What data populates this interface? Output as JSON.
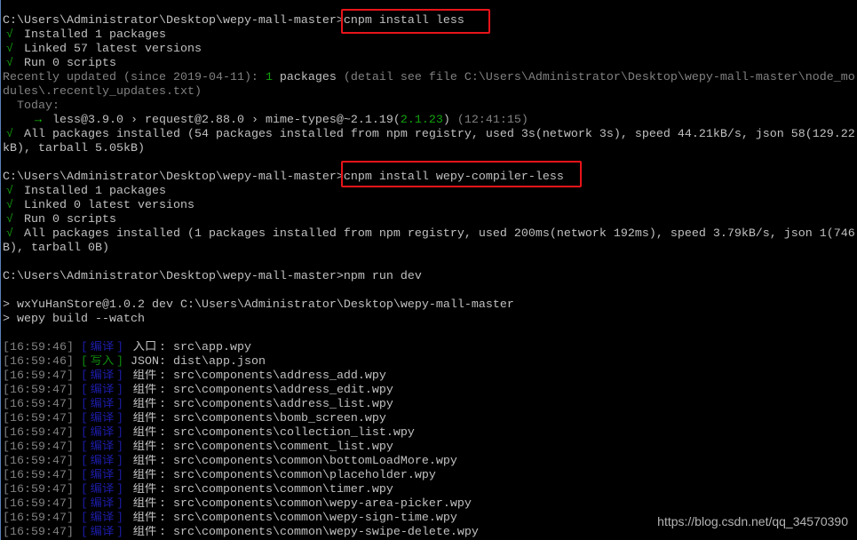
{
  "colors": {
    "w": "#c0c0c0",
    "g": "#808080",
    "gr": "#13a10e",
    "dg": "#0f8a0f",
    "ar": "#16c60c",
    "b": "#1c1ca8"
  },
  "lines": [
    [],
    [
      [
        "C:\\Users\\Administrator\\Desktop\\wepy-mall-master>cnpm install less",
        "w"
      ]
    ],
    [
      [
        "√",
        "gr",
        1
      ],
      [
        " Installed 1 packages",
        "w"
      ]
    ],
    [
      [
        "√",
        "gr",
        1
      ],
      [
        " Linked 57 latest versions",
        "w"
      ]
    ],
    [
      [
        "√",
        "gr",
        1
      ],
      [
        " Run 0 scripts",
        "w"
      ]
    ],
    [
      [
        "Recently updated (since 2019-04-11): ",
        "g"
      ],
      [
        "1",
        "gr"
      ],
      [
        " packages ",
        "w"
      ],
      [
        "(detail see file C:\\Users\\Administrator\\Desktop\\wepy-mall-master\\node_mo",
        "g"
      ]
    ],
    [
      [
        "dules\\.recently_updates.txt)",
        "g"
      ]
    ],
    [
      [
        "  Today:",
        "g"
      ]
    ],
    [
      [
        "    ",
        "w"
      ],
      [
        "→",
        "ar",
        1
      ],
      [
        " less@3.9.0 › request@2.88.0 › mime-types@~2.1.19(",
        "w"
      ],
      [
        "2.1.23",
        "gr"
      ],
      [
        ") ",
        "w"
      ],
      [
        "(12:41:15)",
        "g"
      ]
    ],
    [
      [
        "√",
        "gr",
        1
      ],
      [
        " All packages installed (54 packages installed from npm registry, used 3s(network 3s), speed 44.21kB/s, json 58(129.22",
        "w"
      ]
    ],
    [
      [
        "kB), tarball 5.05kB)",
        "w"
      ]
    ],
    [],
    [
      [
        "C:\\Users\\Administrator\\Desktop\\wepy-mall-master>cnpm install wepy-compiler-less",
        "w"
      ]
    ],
    [
      [
        "√",
        "gr",
        1
      ],
      [
        " Installed 1 packages",
        "w"
      ]
    ],
    [
      [
        "√",
        "gr",
        1
      ],
      [
        " Linked 0 latest versions",
        "w"
      ]
    ],
    [
      [
        "√",
        "gr",
        1
      ],
      [
        " Run 0 scripts",
        "w"
      ]
    ],
    [
      [
        "√",
        "gr",
        1
      ],
      [
        " All packages installed (1 packages installed from npm registry, used 200ms(network 192ms), speed 3.79kB/s, json 1(746",
        "w"
      ]
    ],
    [
      [
        "B), tarball 0B)",
        "w"
      ]
    ],
    [],
    [
      [
        "C:\\Users\\Administrator\\Desktop\\wepy-mall-master>npm run dev",
        "w"
      ]
    ],
    [],
    [
      [
        "> wxYuHanStore@1.0.2 dev C:\\Users\\Administrator\\Desktop\\wepy-mall-master",
        "w"
      ]
    ],
    [
      [
        "> wepy build --watch",
        "w"
      ]
    ],
    [],
    [
      [
        "[16:59:46] ",
        "g"
      ],
      [
        "[",
        "b"
      ],
      [
        "编译",
        "b",
        1
      ],
      [
        "] ",
        "b"
      ],
      [
        "入口",
        "w",
        1
      ],
      [
        ": src\\app.wpy",
        "w"
      ]
    ],
    [
      [
        "[16:59:46] ",
        "g"
      ],
      [
        "[",
        "dg"
      ],
      [
        "写入",
        "dg",
        1
      ],
      [
        "] ",
        "dg"
      ],
      [
        "JSON: dist\\app.json",
        "w"
      ]
    ],
    [
      [
        "[16:59:47] ",
        "g"
      ],
      [
        "[",
        "b"
      ],
      [
        "编译",
        "b",
        1
      ],
      [
        "] ",
        "b"
      ],
      [
        "组件",
        "w",
        1
      ],
      [
        ": src\\components\\address_add.wpy",
        "w"
      ]
    ],
    [
      [
        "[16:59:47] ",
        "g"
      ],
      [
        "[",
        "b"
      ],
      [
        "编译",
        "b",
        1
      ],
      [
        "] ",
        "b"
      ],
      [
        "组件",
        "w",
        1
      ],
      [
        ": src\\components\\address_edit.wpy",
        "w"
      ]
    ],
    [
      [
        "[16:59:47] ",
        "g"
      ],
      [
        "[",
        "b"
      ],
      [
        "编译",
        "b",
        1
      ],
      [
        "] ",
        "b"
      ],
      [
        "组件",
        "w",
        1
      ],
      [
        ": src\\components\\address_list.wpy",
        "w"
      ]
    ],
    [
      [
        "[16:59:47] ",
        "g"
      ],
      [
        "[",
        "b"
      ],
      [
        "编译",
        "b",
        1
      ],
      [
        "] ",
        "b"
      ],
      [
        "组件",
        "w",
        1
      ],
      [
        ": src\\components\\bomb_screen.wpy",
        "w"
      ]
    ],
    [
      [
        "[16:59:47] ",
        "g"
      ],
      [
        "[",
        "b"
      ],
      [
        "编译",
        "b",
        1
      ],
      [
        "] ",
        "b"
      ],
      [
        "组件",
        "w",
        1
      ],
      [
        ": src\\components\\collection_list.wpy",
        "w"
      ]
    ],
    [
      [
        "[16:59:47] ",
        "g"
      ],
      [
        "[",
        "b"
      ],
      [
        "编译",
        "b",
        1
      ],
      [
        "] ",
        "b"
      ],
      [
        "组件",
        "w",
        1
      ],
      [
        ": src\\components\\comment_list.wpy",
        "w"
      ]
    ],
    [
      [
        "[16:59:47] ",
        "g"
      ],
      [
        "[",
        "b"
      ],
      [
        "编译",
        "b",
        1
      ],
      [
        "] ",
        "b"
      ],
      [
        "组件",
        "w",
        1
      ],
      [
        ": src\\components\\common\\bottomLoadMore.wpy",
        "w"
      ]
    ],
    [
      [
        "[16:59:47] ",
        "g"
      ],
      [
        "[",
        "b"
      ],
      [
        "编译",
        "b",
        1
      ],
      [
        "] ",
        "b"
      ],
      [
        "组件",
        "w",
        1
      ],
      [
        ": src\\components\\common\\placeholder.wpy",
        "w"
      ]
    ],
    [
      [
        "[16:59:47] ",
        "g"
      ],
      [
        "[",
        "b"
      ],
      [
        "编译",
        "b",
        1
      ],
      [
        "] ",
        "b"
      ],
      [
        "组件",
        "w",
        1
      ],
      [
        ": src\\components\\common\\timer.wpy",
        "w"
      ]
    ],
    [
      [
        "[16:59:47] ",
        "g"
      ],
      [
        "[",
        "b"
      ],
      [
        "编译",
        "b",
        1
      ],
      [
        "] ",
        "b"
      ],
      [
        "组件",
        "w",
        1
      ],
      [
        ": src\\components\\common\\wepy-area-picker.wpy",
        "w"
      ]
    ],
    [
      [
        "[16:59:47] ",
        "g"
      ],
      [
        "[",
        "b"
      ],
      [
        "编译",
        "b",
        1
      ],
      [
        "] ",
        "b"
      ],
      [
        "组件",
        "w",
        1
      ],
      [
        ": src\\components\\common\\wepy-sign-time.wpy",
        "w"
      ]
    ],
    [
      [
        "[16:59:47] ",
        "g"
      ],
      [
        "[",
        "b"
      ],
      [
        "编译",
        "b",
        1
      ],
      [
        "] ",
        "b"
      ],
      [
        "组件",
        "w",
        1
      ],
      [
        ": src\\components\\common\\wepy-swipe-delete.wpy",
        "w"
      ]
    ]
  ],
  "watermark": "https://blog.csdn.net/qq_34570390"
}
